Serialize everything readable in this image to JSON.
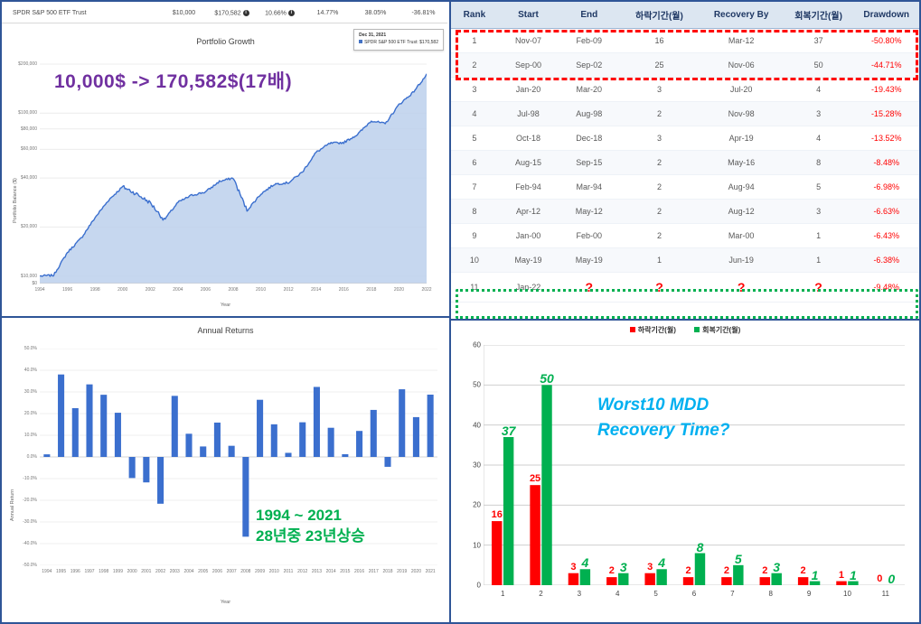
{
  "summary": {
    "name": "SPDR S&P 500 ETF Trust",
    "initial_balance": "$10,000",
    "final_balance": "$170,582",
    "cagr": "10.66%",
    "stdev": "14.77%",
    "best_year": "38.05%",
    "worst_year": "-36.81%"
  },
  "growth": {
    "title": "Portfolio Growth",
    "tooltip_date": "Dec 31, 2021",
    "tooltip_series": "SPDR S&P 500 ETF Trust: $170,582",
    "overlay_note": "10,000$ -> 170,582$(17배)",
    "accent_color": "#4472c4"
  },
  "annual": {
    "title": "Annual Returns",
    "overlay_line1": "1994 ~ 2021",
    "overlay_line2": "28년중 23년상승",
    "accent_color": "#3b6fce"
  },
  "table": {
    "headers": [
      "Rank",
      "Start",
      "End",
      "하락기간(월)",
      "Recovery By",
      "회복기간(월)",
      "Drawdown"
    ],
    "rows": [
      {
        "rank": "1",
        "start": "Nov-07",
        "end": "Feb-09",
        "decline": "16",
        "recovery_by": "Mar-12",
        "recovery": "37",
        "drawdown": "-50.80%"
      },
      {
        "rank": "2",
        "start": "Sep-00",
        "end": "Sep-02",
        "decline": "25",
        "recovery_by": "Nov-06",
        "recovery": "50",
        "drawdown": "-44.71%"
      },
      {
        "rank": "3",
        "start": "Jan-20",
        "end": "Mar-20",
        "decline": "3",
        "recovery_by": "Jul-20",
        "recovery": "4",
        "drawdown": "-19.43%"
      },
      {
        "rank": "4",
        "start": "Jul-98",
        "end": "Aug-98",
        "decline": "2",
        "recovery_by": "Nov-98",
        "recovery": "3",
        "drawdown": "-15.28%"
      },
      {
        "rank": "5",
        "start": "Oct-18",
        "end": "Dec-18",
        "decline": "3",
        "recovery_by": "Apr-19",
        "recovery": "4",
        "drawdown": "-13.52%"
      },
      {
        "rank": "6",
        "start": "Aug-15",
        "end": "Sep-15",
        "decline": "2",
        "recovery_by": "May-16",
        "recovery": "8",
        "drawdown": "-8.48%"
      },
      {
        "rank": "7",
        "start": "Feb-94",
        "end": "Mar-94",
        "decline": "2",
        "recovery_by": "Aug-94",
        "recovery": "5",
        "drawdown": "-6.98%"
      },
      {
        "rank": "8",
        "start": "Apr-12",
        "end": "May-12",
        "decline": "2",
        "recovery_by": "Aug-12",
        "recovery": "3",
        "drawdown": "-6.63%"
      },
      {
        "rank": "9",
        "start": "Jan-00",
        "end": "Feb-00",
        "decline": "2",
        "recovery_by": "Mar-00",
        "recovery": "1",
        "drawdown": "-6.43%"
      },
      {
        "rank": "10",
        "start": "May-19",
        "end": "May-19",
        "decline": "1",
        "recovery_by": "Jun-19",
        "recovery": "1",
        "drawdown": "-6.38%"
      },
      {
        "rank": "11",
        "start": "Jan-22",
        "end": "?",
        "decline": "?",
        "recovery_by": "?",
        "recovery": "?",
        "drawdown": "-9.48%"
      }
    ]
  },
  "bars": {
    "legend_decline": "하락기간(월)",
    "legend_recovery": "회복기간(월)",
    "overlay_line1": "Worst10 MDD",
    "overlay_line2": "Recovery Time?",
    "decline_color": "#ff0000",
    "recovery_color": "#00b050",
    "overlay_color": "#00b0f0"
  },
  "chart_data": [
    {
      "type": "area",
      "title": "Portfolio Growth",
      "xlabel": "Year",
      "ylabel": "Portfolio Balance ($)",
      "y_scale": "log",
      "ylim": [
        10000,
        200000
      ],
      "ytick_labels": [
        "$0",
        "$10,000",
        "$20,000",
        "$40,000",
        "$60,000",
        "$80,000",
        "$100,000",
        "$200,000"
      ],
      "xtick_labels": [
        "1994",
        "1996",
        "1998",
        "2000",
        "2002",
        "2004",
        "2006",
        "2008",
        "2010",
        "2012",
        "2014",
        "2016",
        "2018",
        "2020",
        "2022"
      ],
      "grid": true,
      "series": [
        {
          "name": "SPDR S&P 500 ETF Trust",
          "x": [
            1994,
            1995,
            1996,
            1997,
            1998,
            1999,
            2000,
            2001,
            2002,
            2003,
            2004,
            2005,
            2006,
            2007,
            2008,
            2009,
            2010,
            2011,
            2012,
            2013,
            2014,
            2015,
            2016,
            2017,
            2018,
            2019,
            2020,
            2021
          ],
          "values": [
            10120,
            13964,
            17103,
            22827,
            29378,
            35370,
            31940,
            28170,
            22085,
            28317,
            31346,
            32851,
            38075,
            40017,
            25285,
            31938,
            36729,
            37427,
            43416,
            57433,
            65180,
            66027,
            73950,
            89985,
            85936,
            112766,
            133475,
            171751
          ]
        }
      ]
    },
    {
      "type": "bar",
      "title": "Annual Returns",
      "xlabel": "Year",
      "ylabel": "Annual Return",
      "ylim": [
        -50,
        50
      ],
      "ytick_labels": [
        "50.0%",
        "40.0%",
        "30.0%",
        "20.0%",
        "10.0%",
        "0.0%",
        "-10.0%",
        "-20.0%",
        "-30.0%",
        "-40.0%",
        "-50.0%"
      ],
      "categories": [
        "1994",
        "1995",
        "1996",
        "1997",
        "1998",
        "1999",
        "2000",
        "2001",
        "2002",
        "2003",
        "2004",
        "2005",
        "2006",
        "2007",
        "2008",
        "2009",
        "2010",
        "2011",
        "2012",
        "2013",
        "2014",
        "2015",
        "2016",
        "2017",
        "2018",
        "2019",
        "2020",
        "2021"
      ],
      "values": [
        1.2,
        38.05,
        22.5,
        33.48,
        28.69,
        20.39,
        -9.73,
        -11.75,
        -21.59,
        28.18,
        10.7,
        4.83,
        15.85,
        5.14,
        -36.81,
        26.37,
        15.06,
        1.89,
        15.99,
        32.31,
        13.46,
        1.25,
        12.0,
        21.7,
        -4.56,
        31.22,
        18.37,
        28.75
      ]
    },
    {
      "type": "bar",
      "title": "Worst10 MDD Recovery Time?",
      "xlabel": "",
      "ylabel": "",
      "ylim": [
        0,
        60
      ],
      "ytick_labels": [
        "0",
        "10",
        "20",
        "30",
        "40",
        "50",
        "60"
      ],
      "categories": [
        "1",
        "2",
        "3",
        "4",
        "5",
        "6",
        "7",
        "8",
        "9",
        "10",
        "11"
      ],
      "series": [
        {
          "name": "하락기간(월)",
          "values": [
            16,
            25,
            3,
            2,
            3,
            2,
            2,
            2,
            2,
            1,
            0
          ],
          "color": "#ff0000"
        },
        {
          "name": "회복기간(월)",
          "values": [
            37,
            50,
            4,
            3,
            4,
            8,
            5,
            3,
            1,
            1,
            0
          ],
          "color": "#00b050"
        }
      ]
    }
  ]
}
